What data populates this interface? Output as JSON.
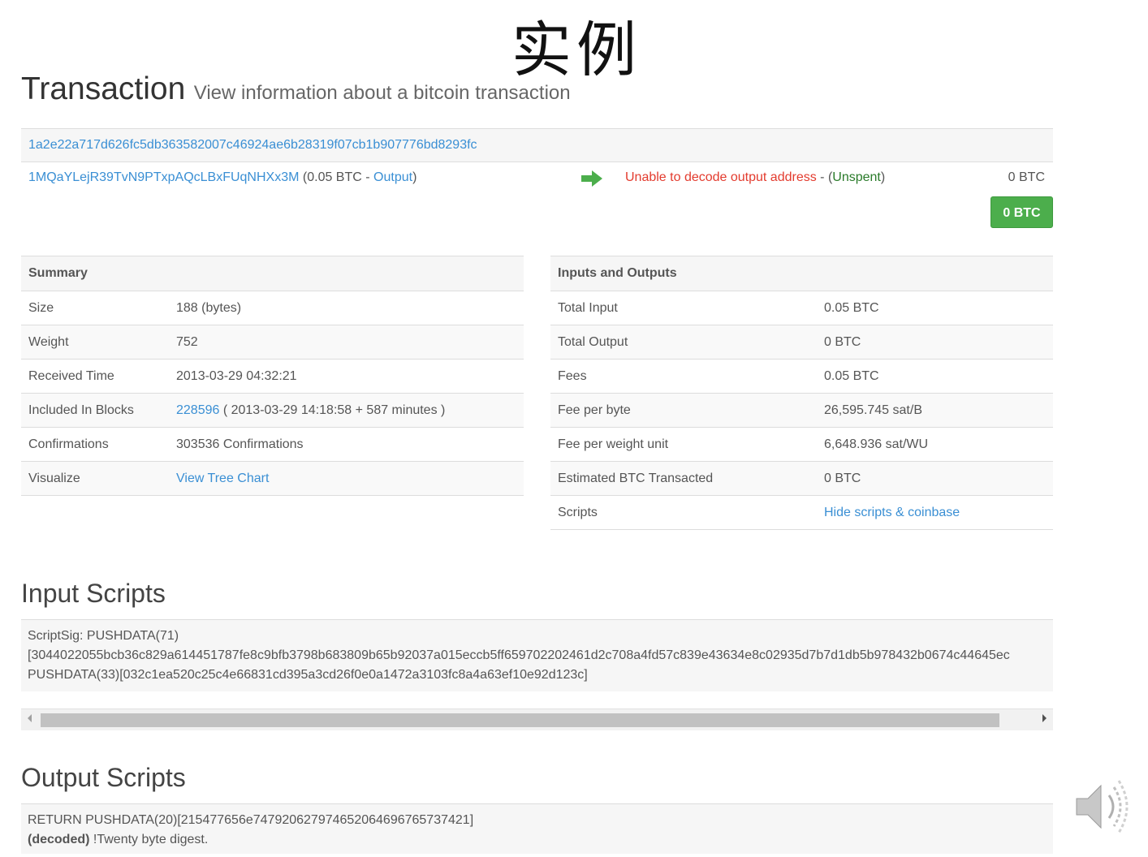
{
  "slide": {
    "title": "实例"
  },
  "header": {
    "title": "Transaction",
    "subtitle": "View information about a bitcoin transaction"
  },
  "tx": {
    "hash": "1a2e22a717d626fc5db363582007c46924ae6b28319f07cb1b907776bd8293fc",
    "input_address": "1MQaYLejR39TvN9PTxpAQcLBxFUqNHXx3M",
    "input_amount_prefix": "(0.05 BTC - ",
    "input_link": "Output",
    "input_suffix": ")",
    "output_error": "Unable to decode output address",
    "output_sep": " - (",
    "output_status": "Unspent",
    "output_suffix": ")",
    "output_amount": "0 BTC",
    "total_button": "0 BTC"
  },
  "summary": {
    "header": "Summary",
    "rows": [
      {
        "key": "Size",
        "value": "188 (bytes)"
      },
      {
        "key": "Weight",
        "value": "752"
      },
      {
        "key": "Received Time",
        "value": "2013-03-29 04:32:21"
      },
      {
        "key": "Included In Blocks",
        "link": "228596",
        "value": " ( 2013-03-29 14:18:58 + 587 minutes )"
      },
      {
        "key": "Confirmations",
        "value": "303536 Confirmations"
      },
      {
        "key": "Visualize",
        "link": "View Tree Chart"
      }
    ]
  },
  "io": {
    "header": "Inputs and Outputs",
    "rows": [
      {
        "key": "Total Input",
        "value": "0.05 BTC"
      },
      {
        "key": "Total Output",
        "value": "0 BTC"
      },
      {
        "key": "Fees",
        "value": "0.05 BTC"
      },
      {
        "key": "Fee per byte",
        "value": "26,595.745 sat/B"
      },
      {
        "key": "Fee per weight unit",
        "value": "6,648.936 sat/WU"
      },
      {
        "key": "Estimated BTC Transacted",
        "value": "0 BTC"
      },
      {
        "key": "Scripts",
        "link": "Hide scripts & coinbase"
      }
    ]
  },
  "input_scripts": {
    "title": "Input Scripts",
    "lines": [
      "ScriptSig: PUSHDATA(71)",
      "[3044022055bcb36c829a614451787fe8c9bfb3798b683809b65b92037a015eccb5ff659702202461d2c708a4fd57c839e43634e8c02935d7b7d1db5b978432b0674c44645ec",
      "PUSHDATA(33)[032c1ea520c25c4e66831cd395a3cd26f0e0a1472a3103fc8a4a63ef10e92d123c]"
    ]
  },
  "output_scripts": {
    "title": "Output Scripts",
    "line1": "RETURN PUSHDATA(20)[215477656e747920627974652064696765737421]",
    "decoded_label": "(decoded)",
    "decoded_value": " !Twenty byte digest."
  }
}
